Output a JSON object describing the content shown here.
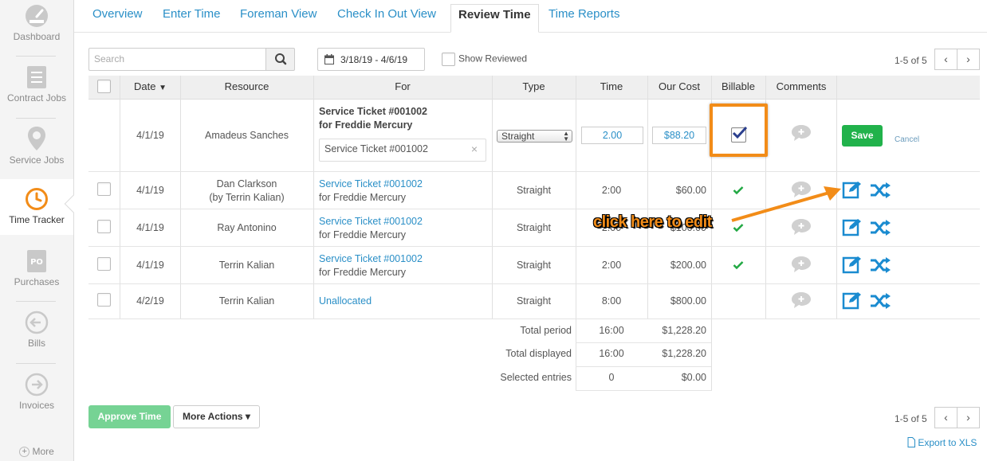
{
  "sidebar": {
    "items": [
      {
        "label": "Dashboard",
        "icon": "gauge-icon"
      },
      {
        "label": "Contract Jobs",
        "icon": "contract-icon"
      },
      {
        "label": "Service Jobs",
        "icon": "map-pin-icon"
      },
      {
        "label": "Time Tracker",
        "icon": "clock-icon"
      },
      {
        "label": "Purchases",
        "icon": "po-icon"
      },
      {
        "label": "Bills",
        "icon": "arrow-left-circle-icon"
      },
      {
        "label": "Invoices",
        "icon": "arrow-right-circle-icon"
      },
      {
        "label": "More",
        "icon": "plus-circle-icon"
      }
    ]
  },
  "tabs": [
    "Overview",
    "Enter Time",
    "Foreman View",
    "Check In Out View",
    "Review Time",
    "Time Reports"
  ],
  "toolbar": {
    "search_placeholder": "Search",
    "date_range": "3/18/19 - 4/6/19",
    "show_reviewed": "Show Reviewed",
    "pager_top": "1-5 of 5"
  },
  "columns": [
    "Date",
    "Resource",
    "For",
    "Type",
    "Time",
    "Our Cost",
    "Billable",
    "Comments"
  ],
  "edit_row": {
    "date": "4/1/19",
    "resource": "Amadeus Sanches",
    "for_line1": "Service Ticket #001002",
    "for_line2": "for Freddie Mercury",
    "for_input": "Service Ticket #001002",
    "type": "Straight",
    "time": "2.00",
    "cost": "$88.20",
    "save": "Save",
    "cancel": "Cancel"
  },
  "rows": [
    {
      "date": "4/1/19",
      "resource": "Dan Clarkson",
      "resource_sub": "(by Terrin Kalian)",
      "for_link": "Service Ticket #001002",
      "for_sub": "for Freddie Mercury",
      "type": "Straight",
      "time": "2:00",
      "cost": "$60.00"
    },
    {
      "date": "4/1/19",
      "resource": "Ray Antonino",
      "resource_sub": "",
      "for_link": "Service Ticket #001002",
      "for_sub": "for Freddie Mercury",
      "type": "Straight",
      "time": "2:00",
      "cost": "$100.00"
    },
    {
      "date": "4/1/19",
      "resource": "Terrin Kalian",
      "resource_sub": "",
      "for_link": "Service Ticket #001002",
      "for_sub": "for Freddie Mercury",
      "type": "Straight",
      "time": "2:00",
      "cost": "$200.00"
    },
    {
      "date": "4/2/19",
      "resource": "Terrin Kalian",
      "resource_sub": "",
      "for_link": "Unallocated",
      "for_sub": "",
      "type": "Straight",
      "time": "8:00",
      "cost": "$800.00"
    }
  ],
  "totals": [
    {
      "label": "Total period",
      "time": "16:00",
      "cost": "$1,228.20"
    },
    {
      "label": "Total displayed",
      "time": "16:00",
      "cost": "$1,228.20"
    },
    {
      "label": "Selected entries",
      "time": "0",
      "cost": "$0.00"
    }
  ],
  "footer": {
    "approve": "Approve Time",
    "more_actions": "More Actions ▾",
    "pager_bottom": "1-5 of 5",
    "export": "Export to XLS"
  },
  "annotation": "click here to edit",
  "colors": {
    "link": "#2a8fc7",
    "save": "#21b24b",
    "approve": "#76d394",
    "annotation": "#f28c18"
  }
}
